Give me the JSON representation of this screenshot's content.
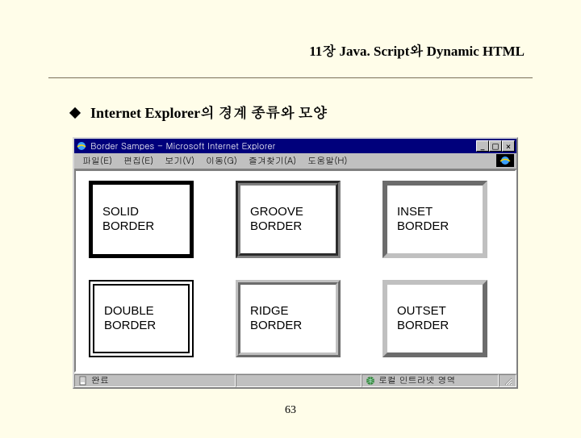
{
  "chapter": "11장 Java. Script와 Dynamic HTML",
  "bullet": "Internet Explorer의 경계 종류와 모양",
  "browser": {
    "title": "Border Sampes - Microsoft Internet Explorer",
    "menus": [
      "파일(E)",
      "편집(E)",
      "보기(V)",
      "이동(G)",
      "즐겨찾기(A)",
      "도움말(H)"
    ],
    "status_left": "완료",
    "status_zone": "로컬 인트라넷 영역",
    "win_min": "_",
    "win_max": "□",
    "win_close": "×"
  },
  "boxes": [
    {
      "name": "solid",
      "label": "SOLID\nBORDER"
    },
    {
      "name": "groove",
      "label": "GROOVE\nBORDER"
    },
    {
      "name": "inset",
      "label": "INSET\nBORDER"
    },
    {
      "name": "double",
      "label": "DOUBLE\nBORDER"
    },
    {
      "name": "ridge",
      "label": "RIDGE\nBORDER"
    },
    {
      "name": "outset",
      "label": "OUTSET\nBORDER"
    }
  ],
  "page_number": "63"
}
